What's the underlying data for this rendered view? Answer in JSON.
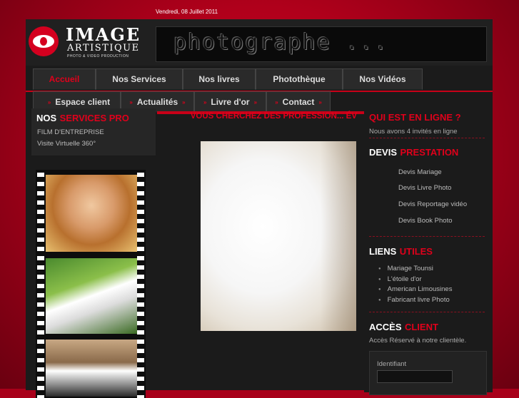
{
  "date": "Vendredi, 08 Juillet 2011",
  "logo": {
    "line1": "IMAGE",
    "line2": "ARTISTIQUE",
    "line3": "PHOTO & VIDEO PRODUCTION"
  },
  "banner_text": "photographe ...",
  "nav": {
    "row1": [
      "Accueil",
      "Nos Services",
      "Nos livres",
      "Photothèque",
      "Nos Vidéos"
    ],
    "row2": [
      "Espace client",
      "Actualités",
      "Livre d'or",
      "Contact"
    ]
  },
  "left": {
    "title_white": "NOS",
    "title_red": "SERVICES PRO",
    "items": [
      "FILM D'ENTREPRISE",
      "Visite Virtuelle 360°"
    ]
  },
  "middle": {
    "title": "VOUS CHERCHEZ DES PROFESSION... ÉV"
  },
  "right": {
    "online": {
      "title": "QUI EST EN LIGNE ?",
      "text": "Nous avons 4 invités en ligne"
    },
    "devis": {
      "title_white": "DEVIS",
      "title_red": "PRESTATION",
      "items": [
        "Devis Mariage",
        "Devis Livre Photo",
        "Devis Reportage vidéo",
        "Devis Book Photo"
      ]
    },
    "liens": {
      "title_white": "LIENS",
      "title_red": "UTILES",
      "items": [
        "Mariage Tounsi",
        "L'étoile d'or",
        "American Limousines",
        "Fabricant livre Photo"
      ]
    },
    "acces": {
      "title_white": "ACCÈS",
      "title_red": "CLIENT",
      "text": "Accès Réservé à notre clientèle.",
      "login_label": "Identifiant"
    }
  },
  "colors": {
    "accent": "#e0001b",
    "background": "#b0001b",
    "panel": "#1b1b1b"
  }
}
